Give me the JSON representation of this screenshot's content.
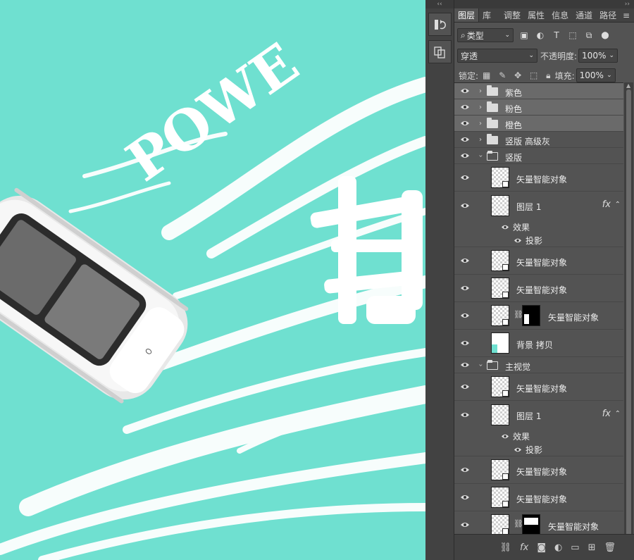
{
  "colors": {
    "canvas_bg": "#6fe0d0",
    "panel_bg": "#535353",
    "selected_row": "#6a6a6a"
  },
  "panel": {
    "tabs": [
      "图层",
      "库",
      "调整",
      "属性",
      "信息",
      "通道",
      "路径"
    ],
    "active_tab": "图层",
    "filter_kind": "类型",
    "filter_icons": [
      "image-filter-icon",
      "adjustment-filter-icon",
      "type-filter-icon",
      "shape-filter-icon",
      "smartobject-filter-icon",
      "filter-toggle"
    ],
    "blend_mode": "穿透",
    "opacity_label": "不透明度:",
    "opacity_value": "100%",
    "lock_label": "锁定:",
    "fill_label": "填充:",
    "fill_value": "100%",
    "layers": [
      {
        "name": "紫色",
        "kind": "group",
        "expanded": false,
        "selected": true
      },
      {
        "name": "粉色",
        "kind": "group",
        "expanded": false,
        "selected": true
      },
      {
        "name": "橙色",
        "kind": "group",
        "expanded": false,
        "selected": true
      },
      {
        "name": "竖版 高级灰",
        "kind": "group",
        "expanded": false
      },
      {
        "name": "竖版",
        "kind": "group",
        "expanded": true
      },
      {
        "name": "矢量智能对象",
        "kind": "smart"
      },
      {
        "name": "图层 1",
        "kind": "layer",
        "fx": true
      },
      {
        "name": "效果",
        "kind": "effects"
      },
      {
        "name": "投影",
        "kind": "effect"
      },
      {
        "name": "矢量智能对象",
        "kind": "smart"
      },
      {
        "name": "矢量智能对象",
        "kind": "smart"
      },
      {
        "name": "矢量智能对象",
        "kind": "smart-mask",
        "mask": "white-bar-left"
      },
      {
        "name": "背景 拷贝",
        "kind": "layer",
        "thumb": "teal"
      },
      {
        "name": "主视觉",
        "kind": "group",
        "expanded": true
      },
      {
        "name": "矢量智能对象",
        "kind": "smart"
      },
      {
        "name": "图层 1",
        "kind": "layer",
        "fx": true
      },
      {
        "name": "效果",
        "kind": "effects"
      },
      {
        "name": "投影",
        "kind": "effect"
      },
      {
        "name": "矢量智能对象",
        "kind": "smart"
      },
      {
        "name": "矢量智能对象",
        "kind": "smart"
      },
      {
        "name": "矢量智能对象",
        "kind": "smart-mask",
        "mask": "white-top"
      }
    ],
    "fx_symbol": "fx",
    "bottom_icons": [
      "link-icon",
      "fx-icon",
      "mask-icon",
      "adjustment-icon",
      "new-group-icon",
      "new-layer-icon",
      "trash-icon"
    ]
  },
  "canvas": {
    "brush_text": "POWE"
  }
}
